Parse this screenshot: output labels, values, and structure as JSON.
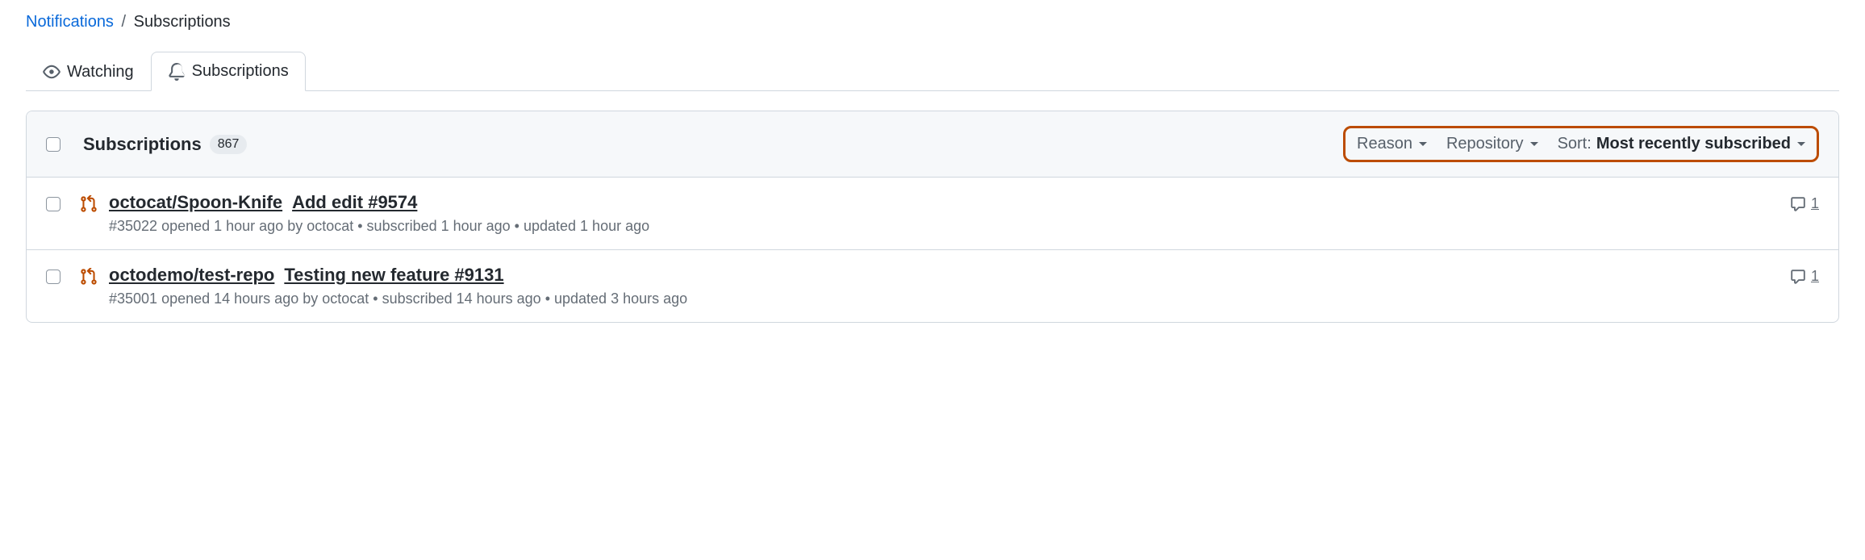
{
  "breadcrumb": {
    "parent": "Notifications",
    "current": "Subscriptions"
  },
  "tabs": {
    "watching": "Watching",
    "subscriptions": "Subscriptions"
  },
  "header": {
    "title": "Subscriptions",
    "count": "867"
  },
  "filters": {
    "reason": "Reason",
    "repository": "Repository",
    "sort_label": "Sort:",
    "sort_value": "Most recently subscribed"
  },
  "rows": [
    {
      "repo": "octocat/Spoon-Knife",
      "title": "Add edit #9574",
      "meta": "#35022 opened 1 hour ago by octocat • subscribed 1 hour ago • updated 1 hour ago",
      "comments": "1"
    },
    {
      "repo": "octodemo/test-repo",
      "title": "Testing new feature #9131",
      "meta": "#35001 opened 14 hours ago by octocat • subscribed 14 hours ago • updated 3 hours ago",
      "comments": "1"
    }
  ]
}
